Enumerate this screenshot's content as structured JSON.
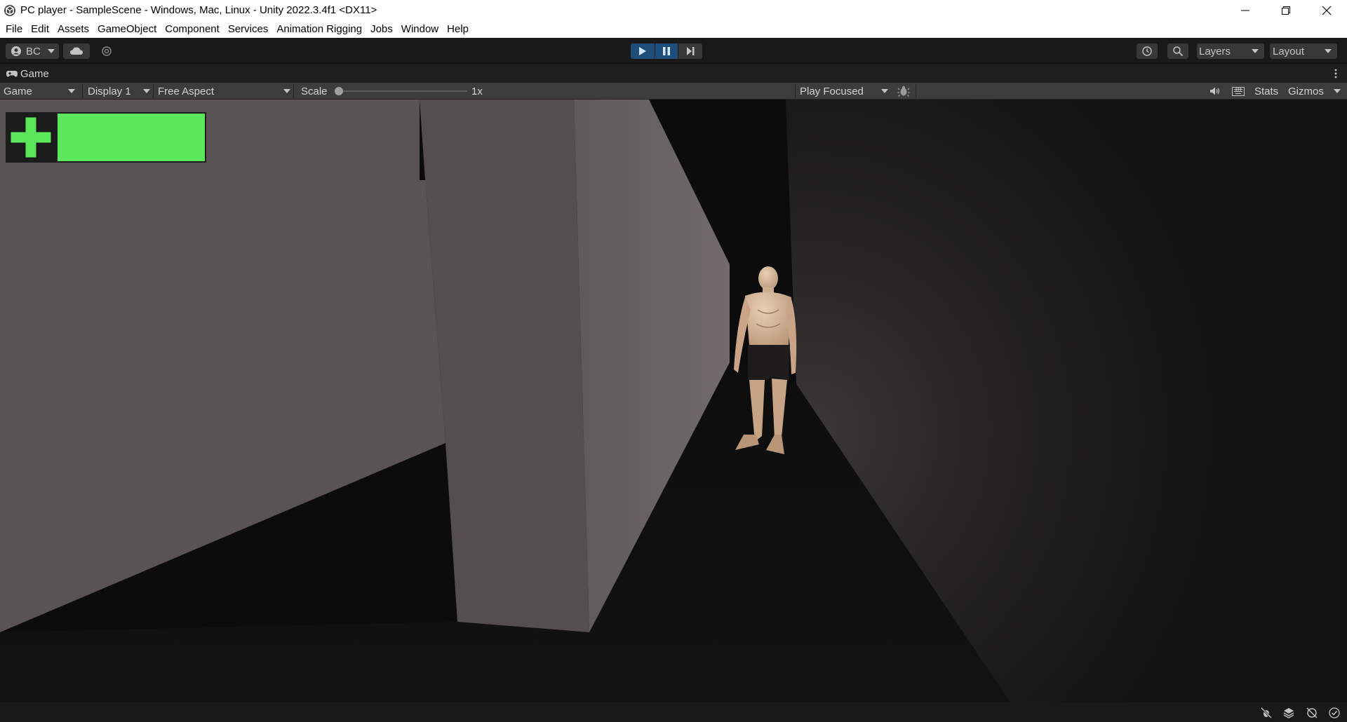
{
  "window": {
    "title": "PC player - SampleScene - Windows, Mac, Linux - Unity 2022.3.4f1 <DX11>",
    "icon": "unity-logo-icon"
  },
  "menu": [
    "File",
    "Edit",
    "Assets",
    "GameObject",
    "Component",
    "Services",
    "Animation Rigging",
    "Jobs",
    "Window",
    "Help"
  ],
  "toolbar": {
    "account_label": "BC",
    "layers_label": "Layers",
    "layout_label": "Layout",
    "play_state": "playing",
    "accent_color": "#1f4e7a"
  },
  "game_tab": {
    "label": "Game"
  },
  "game_bar": {
    "view_select": "Game",
    "display_select": "Display 1",
    "aspect_select": "Free Aspect",
    "scale_label": "Scale",
    "scale_value": "1x",
    "play_mode_select": "Play Focused",
    "stats_label": "Stats",
    "gizmos_label": "Gizmos"
  },
  "hud": {
    "health_color": "#5ce65c",
    "health_icon": "plus-icon",
    "health_fraction": 1.0
  }
}
